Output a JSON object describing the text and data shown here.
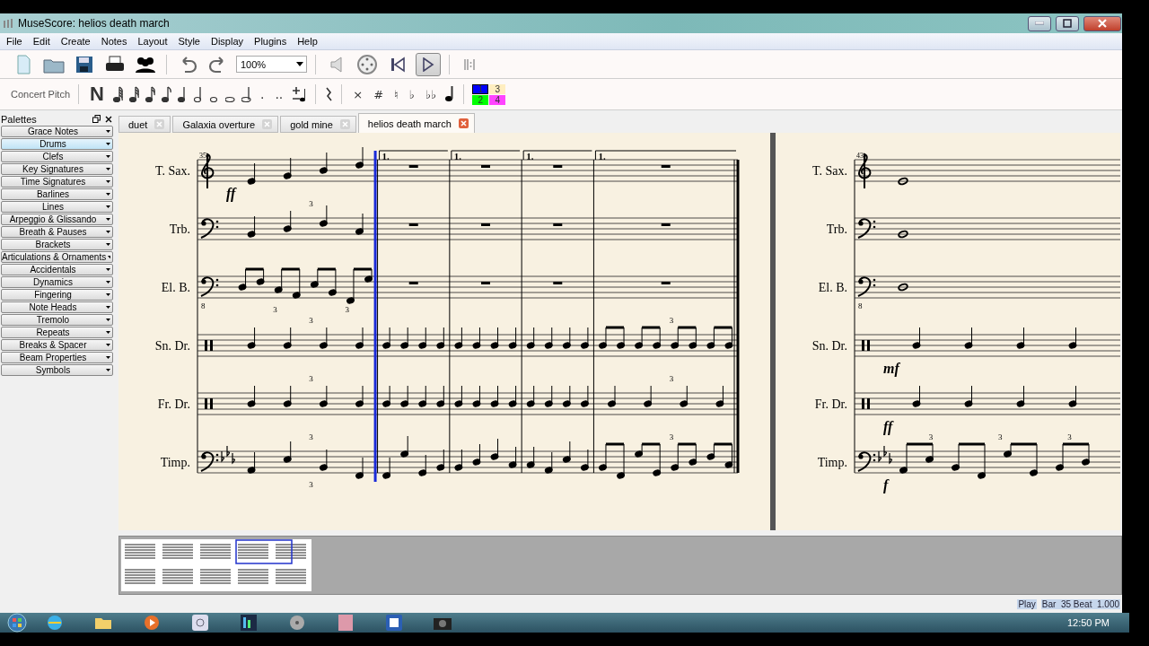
{
  "window": {
    "title": "MuseScore: helios death march"
  },
  "menu": [
    "File",
    "Edit",
    "Create",
    "Notes",
    "Layout",
    "Style",
    "Display",
    "Plugins",
    "Help"
  ],
  "toolbar": {
    "zoom": "100%",
    "play_pressed": true
  },
  "note_input": {
    "concert_pitch": "Concert Pitch",
    "note_mode": "N",
    "dots": [
      ".",
      ".."
    ],
    "accidentals": [
      "×",
      "#",
      "♮",
      "♭",
      "♭♭"
    ],
    "voices": [
      {
        "label": "1",
        "color": "#0000ff",
        "selected": true
      },
      {
        "label": "3",
        "color": "#ffeec0",
        "selected": false
      },
      {
        "label": "2",
        "color": "#00ff00",
        "selected": false
      },
      {
        "label": "4",
        "color": "#ff44ff",
        "selected": false
      }
    ]
  },
  "palettes": {
    "title": "Palettes",
    "items": [
      {
        "label": "Grace Notes",
        "selected": false
      },
      {
        "label": "Drums",
        "selected": true
      },
      {
        "label": "Clefs",
        "selected": false
      },
      {
        "label": "Key Signatures",
        "selected": false
      },
      {
        "label": "Time Signatures",
        "selected": false
      },
      {
        "label": "Barlines",
        "selected": false
      },
      {
        "label": "Lines",
        "selected": false
      },
      {
        "label": "Arpeggio & Glissando",
        "selected": false
      },
      {
        "label": "Breath & Pauses",
        "selected": false
      },
      {
        "label": "Brackets",
        "selected": false
      },
      {
        "label": "Articulations & Ornaments",
        "selected": false
      },
      {
        "label": "Accidentals",
        "selected": false
      },
      {
        "label": "Dynamics",
        "selected": false
      },
      {
        "label": "Fingering",
        "selected": false
      },
      {
        "label": "Note Heads",
        "selected": false
      },
      {
        "label": "Tremolo",
        "selected": false
      },
      {
        "label": "Repeats",
        "selected": false
      },
      {
        "label": "Breaks & Spacer",
        "selected": false
      },
      {
        "label": "Beam Properties",
        "selected": false
      },
      {
        "label": "Symbols",
        "selected": false
      }
    ]
  },
  "tabs": [
    {
      "label": "duet",
      "selected": false
    },
    {
      "label": "Galaxia overture",
      "selected": false
    },
    {
      "label": "gold mine",
      "selected": false
    },
    {
      "label": "helios death march",
      "selected": true
    }
  ],
  "score": {
    "pages": [
      {
        "first_measure": "35",
        "measures": [
          {
            "cursor": false
          },
          {
            "cursor": true
          },
          {
            "cursor": false
          },
          {
            "cursor": false
          },
          {
            "cursor": false
          }
        ],
        "staves": [
          {
            "name": "T. Sax.",
            "kind": "treble",
            "measures": [
              {
                "kind": "notes",
                "dynamic": "ff"
              },
              {
                "kind": "rest",
                "volta": "1."
              },
              {
                "kind": "rest",
                "volta": "1."
              },
              {
                "kind": "rest",
                "volta": "1."
              },
              {
                "kind": "rest",
                "volta": "1."
              }
            ]
          },
          {
            "name": "Trb.",
            "kind": "bass",
            "measures": [
              {
                "kind": "notes",
                "tuplets_above": [
                  "3"
                ]
              },
              {
                "kind": "rest"
              },
              {
                "kind": "rest"
              },
              {
                "kind": "rest"
              },
              {
                "kind": "rest"
              }
            ]
          },
          {
            "name": "El. B.",
            "kind": "bass",
            "clef_label": "8",
            "measures": [
              {
                "kind": "eighths",
                "tuplets_below": [
                  "3",
                  "3"
                ]
              },
              {
                "kind": "rest"
              },
              {
                "kind": "rest"
              },
              {
                "kind": "rest"
              },
              {
                "kind": "rest"
              }
            ]
          },
          {
            "name": "Sn. Dr.",
            "kind": "percussion",
            "measures": [
              {
                "kind": "notes",
                "tuplets_above": [
                  "3"
                ]
              },
              {
                "kind": "notes"
              },
              {
                "kind": "notes"
              },
              {
                "kind": "notes"
              },
              {
                "kind": "eighths",
                "tuplets_above": [
                  "3"
                ]
              }
            ]
          },
          {
            "name": "Fr. Dr.",
            "kind": "percussion",
            "measures": [
              {
                "kind": "notes",
                "tuplets_above": [
                  "3"
                ]
              },
              {
                "kind": "notes"
              },
              {
                "kind": "notes"
              },
              {
                "kind": "notes"
              },
              {
                "kind": "notes",
                "tuplets_above": [
                  "3"
                ]
              }
            ]
          },
          {
            "name": "Timp.",
            "kind": "flatbass",
            "measures": [
              {
                "kind": "notes",
                "tuplets_above": [
                  "3"
                ],
                "tuplets_below": [
                  "3"
                ]
              },
              {
                "kind": "notes"
              },
              {
                "kind": "notes"
              },
              {
                "kind": "notes"
              },
              {
                "kind": "eighths",
                "tuplets_above": [
                  "3"
                ]
              }
            ]
          }
        ]
      },
      {
        "first_measure": "43",
        "measures": [
          {
            "cursor": false
          }
        ],
        "staves": [
          {
            "name": "T. Sax.",
            "kind": "treble",
            "measures": [
              {
                "kind": "whole"
              }
            ]
          },
          {
            "name": "Trb.",
            "kind": "bass",
            "measures": [
              {
                "kind": "whole"
              }
            ]
          },
          {
            "name": "El. B.",
            "kind": "bass",
            "clef_label": "8",
            "measures": [
              {
                "kind": "whole"
              }
            ]
          },
          {
            "name": "Sn. Dr.",
            "kind": "percussion",
            "measures": [
              {
                "kind": "notes",
                "dynamic": "mf"
              }
            ]
          },
          {
            "name": "Fr. Dr.",
            "kind": "percussion",
            "measures": [
              {
                "kind": "notes",
                "dynamic": "ff"
              }
            ]
          },
          {
            "name": "Timp.",
            "kind": "flatbass",
            "measures": [
              {
                "kind": "eighths",
                "dynamic": "f",
                "tuplets_above": [
                  "3",
                  "3",
                  "3"
                ]
              }
            ]
          }
        ]
      }
    ]
  },
  "status_bar": {
    "mode": "Play",
    "position": "Bar  35 Beat  1.000"
  },
  "taskbar": {
    "clock": "12:50 PM"
  }
}
